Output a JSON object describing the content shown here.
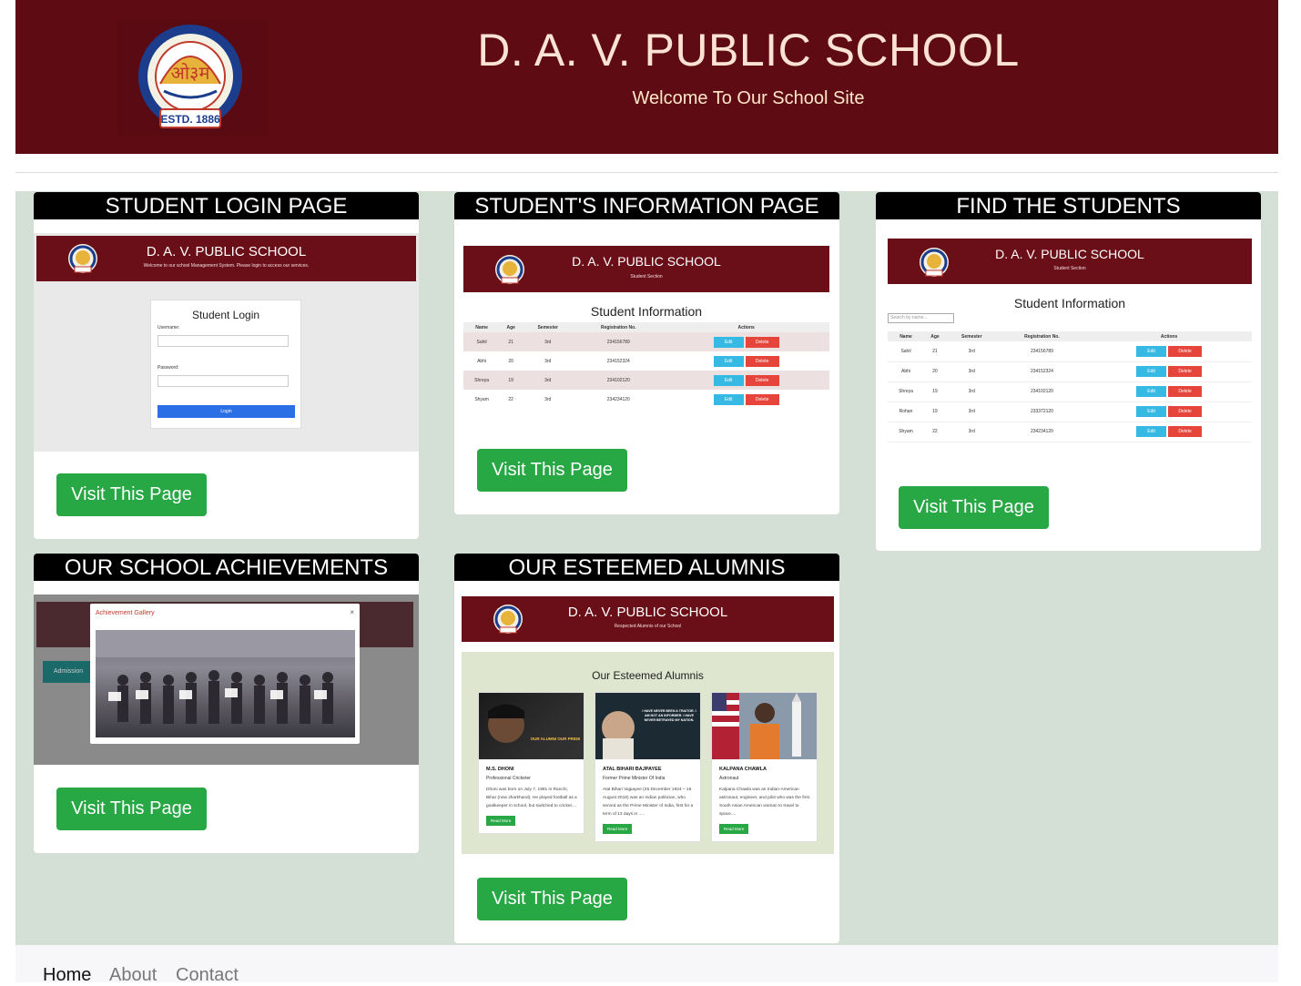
{
  "header": {
    "title": "D. A. V. PUBLIC SCHOOL",
    "subtitle": "Welcome To Our School Site",
    "logo_text_top": "D.A.V. COLLEGE MANAGING COMMITTEE",
    "logo_text_center": "ओ३म",
    "logo_text_bottom": "ESTD. 1886"
  },
  "cards": {
    "login": {
      "title": "STUDENT LOGIN PAGE",
      "button": "Visit This Page",
      "preview": {
        "school": "D. A. V. PUBLIC SCHOOL",
        "tagline": "Welcome to our school Management System. Please login to access our services.",
        "form_title": "Student Login",
        "username_label": "Username:",
        "password_label": "Password:",
        "login_button": "Login"
      }
    },
    "info": {
      "title": "STUDENT'S INFORMATION PAGE",
      "button": "Visit This Page",
      "preview": {
        "school": "D. A. V. PUBLIC SCHOOL",
        "section": "Student Section",
        "heading": "Student Information",
        "columns": [
          "Name",
          "Age",
          "Semester",
          "Registration No.",
          "Actions"
        ],
        "rows": [
          [
            "Sahil",
            "21",
            "3rd",
            "234156789"
          ],
          [
            "Abhi",
            "20",
            "3rd",
            "234152324"
          ],
          [
            "Shreya",
            "19",
            "3rd",
            "234102120"
          ],
          [
            "Shyam",
            "22",
            "3rd",
            "234234120"
          ]
        ],
        "edit": "Edit",
        "delete": "Delete"
      }
    },
    "find": {
      "title": "FIND THE STUDENTS",
      "button": "Visit This Page",
      "preview": {
        "school": "D. A. V. PUBLIC SCHOOL",
        "section": "Student Section",
        "heading": "Student Information",
        "search_placeholder": "Search by name...",
        "columns": [
          "Name",
          "Age",
          "Semester",
          "Registration No.",
          "Actions"
        ],
        "rows": [
          [
            "Sahil",
            "21",
            "3rd",
            "234156789"
          ],
          [
            "Abhi",
            "20",
            "3rd",
            "234152324"
          ],
          [
            "Shreya",
            "19",
            "3rd",
            "234102120"
          ],
          [
            "Rohan",
            "19",
            "3rd",
            "233372120"
          ],
          [
            "Shyam",
            "22",
            "3rd",
            "234234120"
          ]
        ],
        "edit": "Edit",
        "delete": "Delete"
      }
    },
    "achievements": {
      "title": "OUR SCHOOL ACHIEVEMENTS",
      "button": "Visit This Page",
      "preview": {
        "modal_title": "Achievement Gallery",
        "close": "×",
        "side_button": "Admission"
      }
    },
    "alumni": {
      "title": "OUR ESTEEMED ALUMNIS",
      "button": "Visit This Page",
      "preview": {
        "school": "D. A. V. PUBLIC SCHOOL",
        "section": "Respected Alumnis of our School",
        "heading": "Our Esteemed Alumnis",
        "read_more": "Read More",
        "people": [
          {
            "name": "M.S. DHONI",
            "role": "Professional Cricketer",
            "desc": "Dhoni was born on July 7, 1981 in Ranchi, Bihar (now Jharkhand). He played football as a goalkeeper in school, but switched to cricket....",
            "img_text": "OUR ALUMNI OUR PRIDE"
          },
          {
            "name": "ATAL BIHARI BAJPAYEE",
            "role": "Former Prime Minister Of India",
            "desc": "Atal Bihari Vajpayee (25 December 1924 – 16 August 2018) was an Indian politician, who served as the Prime Minister of India, first for a term of 13 days in .....",
            "img_text": "I HAVE NEVER BEEN A TRAITOR. I AM NOT AN INFORMER. I HAVE NEVER BETRAYED MY NATION."
          },
          {
            "name": "KALPANA CHAWLA",
            "role": "Astronaut",
            "desc": "Kalpana Chawla was an Indian-American astronaut, engineer, and pilot who was the first South Asian American woman to travel to space....",
            "img_text": ""
          }
        ]
      }
    }
  },
  "footer": {
    "nav": [
      "Home",
      "About",
      "Contact"
    ]
  },
  "colors": {
    "maroon": "#5e0b14",
    "green": "#28a745",
    "background": "#d4dfd5"
  }
}
